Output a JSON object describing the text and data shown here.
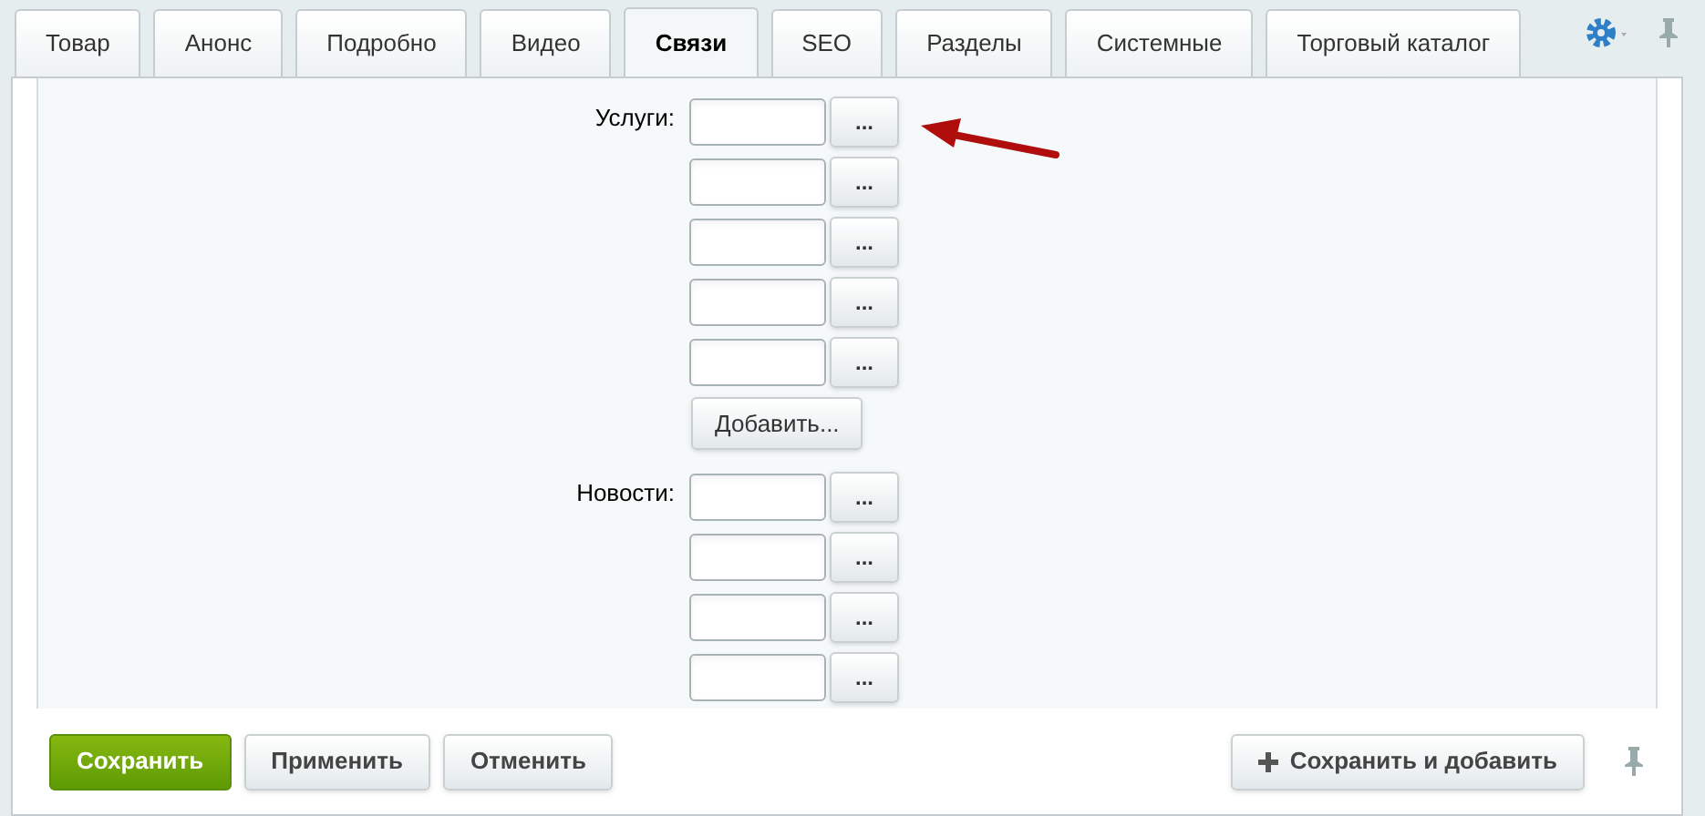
{
  "tabs": [
    {
      "label": "Товар",
      "selected": false
    },
    {
      "label": "Анонс",
      "selected": false
    },
    {
      "label": "Подробно",
      "selected": false
    },
    {
      "label": "Видео",
      "selected": false
    },
    {
      "label": "Связи",
      "selected": true
    },
    {
      "label": "SEO",
      "selected": false
    },
    {
      "label": "Разделы",
      "selected": false
    },
    {
      "label": "Системные",
      "selected": false
    },
    {
      "label": "Торговый каталог",
      "selected": false
    }
  ],
  "sections": [
    {
      "label": "Услуги:",
      "fields": [
        {
          "button": "..."
        },
        {
          "button": "..."
        },
        {
          "button": "..."
        },
        {
          "button": "..."
        },
        {
          "button": "..."
        }
      ],
      "add_button": "Добавить..."
    },
    {
      "label": "Новости:",
      "fields": [
        {
          "button": "..."
        },
        {
          "button": "..."
        },
        {
          "button": "..."
        },
        {
          "button": "..."
        }
      ]
    }
  ],
  "footer": {
    "buttons": [
      {
        "label": "Сохранить",
        "kind": "primary"
      },
      {
        "label": "Применить",
        "kind": "normal"
      },
      {
        "label": "Отменить",
        "kind": "normal"
      },
      {
        "label": "Сохранить и добавить",
        "kind": "add"
      }
    ]
  }
}
